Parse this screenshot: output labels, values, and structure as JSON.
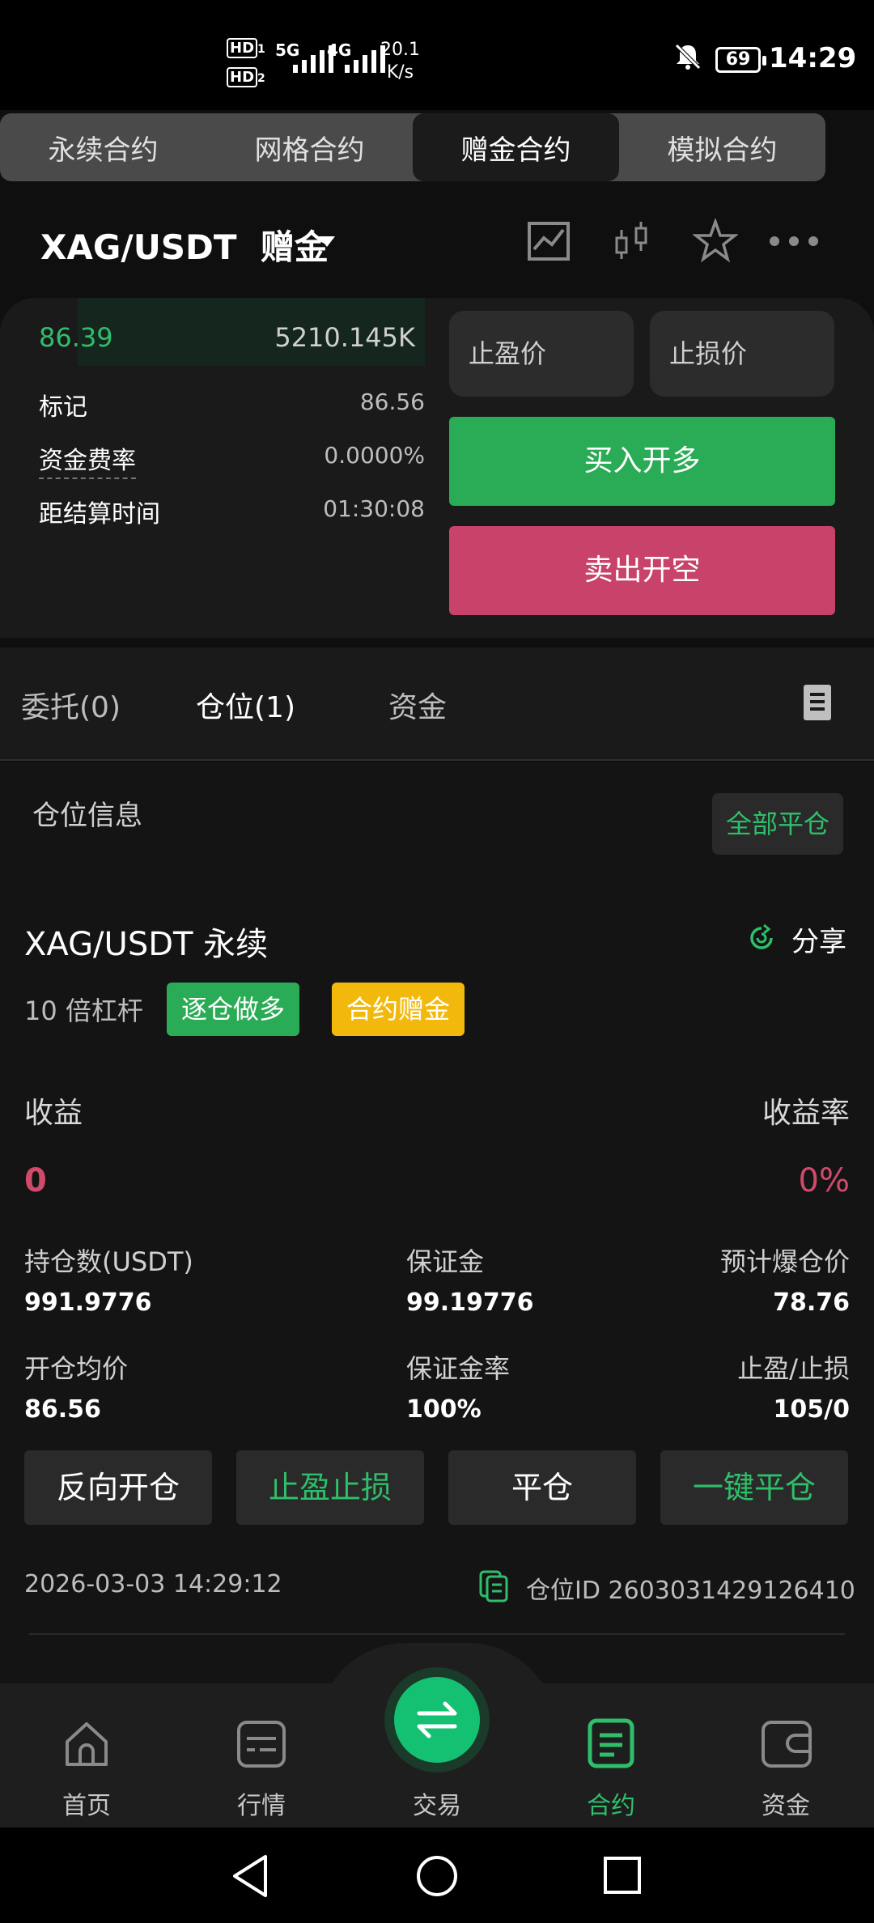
{
  "status_bar": {
    "hd1": "HD",
    "hd1_sub": "1",
    "hd2": "HD",
    "hd2_sub": "2",
    "net1": "5G",
    "net2": "4G",
    "speed_value": "20.1",
    "speed_unit": "K/s",
    "battery": "69",
    "time": "14:29"
  },
  "mode_tabs": [
    {
      "label": "永续合约",
      "active": false
    },
    {
      "label": "网格合约",
      "active": false
    },
    {
      "label": "赠金合约",
      "active": true
    },
    {
      "label": "模拟合约",
      "active": false
    }
  ],
  "header": {
    "pair": "XAG/USDT",
    "tag": "赠金",
    "icons": [
      "chart-icon",
      "candlestick-icon",
      "star-icon",
      "more-icon"
    ]
  },
  "order_book": {
    "price": "86.39",
    "volume": "5210.145K"
  },
  "info": {
    "mark_label": "标记",
    "mark_value": "86.56",
    "funding_label": "资金费率",
    "funding_value": "0.0000%",
    "settle_label": "距结算时间",
    "settle_value": "01:30:08"
  },
  "order_form": {
    "tp_placeholder": "止盈价",
    "sl_placeholder": "止损价",
    "buy_label": "买入开多",
    "sell_label": "卖出开空"
  },
  "order_tabs": [
    {
      "label": "委托(0)",
      "active": false
    },
    {
      "label": "仓位(1)",
      "active": true
    },
    {
      "label": "资金",
      "active": false
    }
  ],
  "position": {
    "section_title": "仓位信息",
    "close_all": "全部平仓",
    "symbol": "XAG/USDT 永续",
    "share": "分享",
    "leverage": "10 倍杠杆",
    "badge_side": "逐仓做多",
    "badge_bonus": "合约赠金",
    "pnl_label": "收益",
    "pnl_value": "0",
    "roe_label": "收益率",
    "roe_value": "0%",
    "size_label": "持仓数(USDT)",
    "size_value": "991.9776",
    "margin_label": "保证金",
    "margin_value": "99.19776",
    "liq_label": "预计爆仓价",
    "liq_value": "78.76",
    "entry_label": "开仓均价",
    "entry_value": "86.56",
    "margin_rate_label": "保证金率",
    "margin_rate_value": "100%",
    "tpsl_label": "止盈/止损",
    "tpsl_value": "105/0",
    "actions": [
      "反向开仓",
      "止盈止损",
      "平仓",
      "一键平仓"
    ],
    "timestamp": "2026-03-03 14:29:12",
    "position_id": "仓位ID 2603031429126410"
  },
  "bottom_nav": [
    {
      "label": "首页",
      "icon": "home-icon",
      "active": false
    },
    {
      "label": "行情",
      "icon": "market-icon",
      "active": false
    },
    {
      "label": "交易",
      "icon": "swap-icon",
      "active": false
    },
    {
      "label": "合约",
      "icon": "contract-icon",
      "active": true
    },
    {
      "label": "资金",
      "icon": "wallet-icon",
      "active": false
    }
  ],
  "colors": {
    "green": "#2aab55",
    "red": "#c8426a",
    "accent": "#2fbf6b",
    "yellow": "#f2b90c"
  }
}
